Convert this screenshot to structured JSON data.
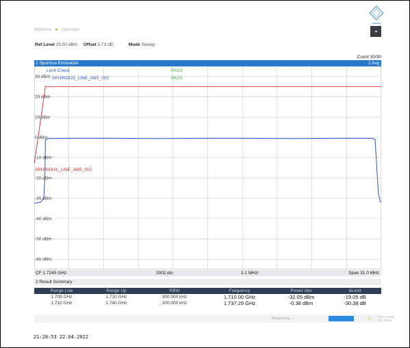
{
  "window": {
    "tabs": [
      "MultiView",
      "Overview"
    ],
    "tab_separator": "★",
    "ref_level_label": "Ref Level",
    "ref_level_value": "25.00 dBm",
    "offset_label": "Offset",
    "offset_value": "5.73 dB",
    "mode_label": "Mode",
    "mode_value": "Sweep",
    "count": "Count 30/30"
  },
  "panel": {
    "title": "1 Spurious Emissions",
    "trace_mode": "1 Avg",
    "limit_check_label": "Limit Check",
    "line_label": "Line",
    "limit_line_name": "SPURIOUS_LINE_ABS_002",
    "limit_line_label_red": "SPURIOUS_LINE_ABS_002",
    "pass_1": "PASS",
    "pass_2": "PASS"
  },
  "axis": {
    "cf": "CF 1.7245 GHz",
    "pts": "2002 pts",
    "step": "3.1 MHz/",
    "span": "Span 31.0 MHz"
  },
  "result_summary": {
    "title": "2 Result Summary",
    "headers": [
      "Range Low",
      "Range Up",
      "RBW",
      "Frequency",
      "Power Abs",
      "ΔLimit"
    ],
    "rows": [
      [
        "1.709 GHz",
        "1.710 GHz",
        "300.000 kHz",
        "1.710 00 GHz",
        "-32.05 dBm",
        "-19.05 dB"
      ],
      [
        "1.710 GHz",
        "1.740 GHz",
        "300.000 kHz",
        "1.737 29 GHz",
        "-0.38 dBm",
        "-30.38 dB"
      ]
    ]
  },
  "status_bar": {
    "text": "Measuring...",
    "version": "22.04.2022 21:28:53"
  },
  "timestamp": "21:28:53  22.04.2022",
  "colors": {
    "title_bar": "#2879c9",
    "trace": "#2a54c9",
    "limit_line": "#dd2222",
    "pass": "#2dbb2d",
    "table_header": "#2f3d55"
  },
  "chart_data": {
    "type": "line",
    "title": "1 Spurious Emissions",
    "xlabel": "",
    "ylabel": "",
    "y_ticks": [
      "30 dBm",
      "20 dBm",
      "10 dBm",
      "0 dBm",
      "-10 dBm",
      "-20 dBm",
      "-30 dBm",
      "-40 dBm",
      "-50 dBm",
      "-60 dBm"
    ],
    "ylim": [
      -65,
      35
    ],
    "xlim_mhz": [
      1709.0,
      1740.0
    ],
    "grid": true,
    "series": [
      {
        "name": "1 Avg",
        "x": [
          1709.0,
          1709.6,
          1709.85,
          1709.95,
          1710.0,
          1710.3,
          1712.0,
          1716.0,
          1720.0,
          1724.0,
          1728.0,
          1732.0,
          1736.0,
          1739.2,
          1739.45,
          1739.6,
          1739.75,
          1739.9,
          1740.0
        ],
        "y": [
          -32.5,
          -31.8,
          -30.0,
          -20.0,
          -1.0,
          -0.6,
          -0.5,
          -0.5,
          -0.6,
          -0.5,
          -0.5,
          -0.6,
          -0.5,
          -0.5,
          -1.0,
          -15.0,
          -28.0,
          -31.5,
          -32.0
        ]
      }
    ],
    "limit_line": {
      "name": "SPURIOUS_LINE_ABS_002",
      "x": [
        1709.0,
        1710.0,
        1740.0
      ],
      "y": [
        -13.0,
        25.0,
        25.0
      ]
    }
  }
}
